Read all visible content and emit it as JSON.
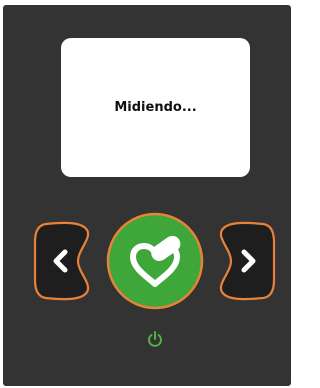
{
  "screen": {
    "message": "Midiendo..."
  },
  "buttons": {
    "prev_icon": "chevron-left-icon",
    "confirm_icon": "heart-pill-icon",
    "next_icon": "chevron-right-icon",
    "power_icon": "power-icon"
  },
  "colors": {
    "device_body": "#333333",
    "screen_bg": "#ffffff",
    "button_dark": "#1e1e1e",
    "accent_orange": "#e8823a",
    "confirm_green": "#3fa73a",
    "power_green": "#4fb341"
  }
}
